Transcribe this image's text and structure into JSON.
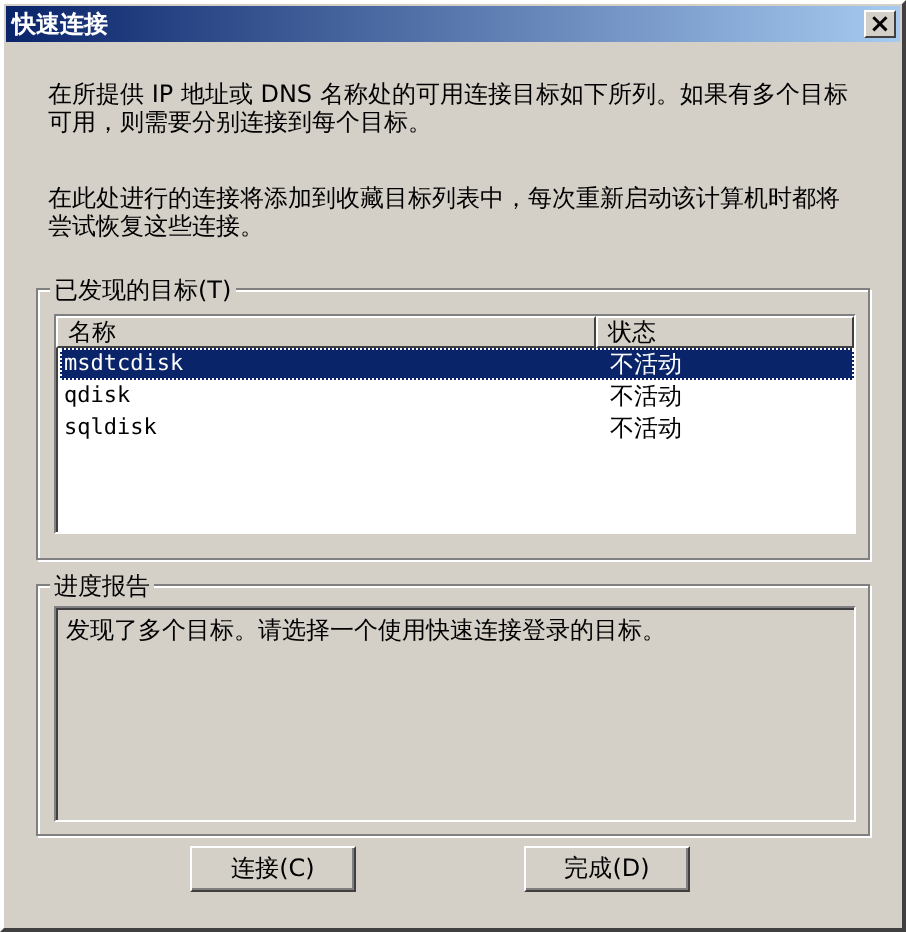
{
  "window": {
    "title": "快速连接",
    "close": "×"
  },
  "paragraphs": [
    "在所提供 IP 地址或 DNS 名称处的可用连接目标如下所列。如果有多个目标可用，则需要分别连接到每个目标。",
    "在此处进行的连接将添加到收藏目标列表中，每次重新启动该计算机时都将尝试恢复这些连接。"
  ],
  "targets": {
    "label": "已发现的目标(T)",
    "columns": [
      "名称",
      "状态"
    ],
    "rows": [
      {
        "name": "msdtcdisk",
        "status": "不活动",
        "selected": true
      },
      {
        "name": "qdisk",
        "status": "不活动",
        "selected": false
      },
      {
        "name": "sqldisk",
        "status": "不活动",
        "selected": false
      }
    ]
  },
  "progress": {
    "label": "进度报告",
    "message": "发现了多个目标。请选择一个使用快速连接登录的目标。"
  },
  "buttons": [
    "连接(C)",
    "完成(D)"
  ]
}
